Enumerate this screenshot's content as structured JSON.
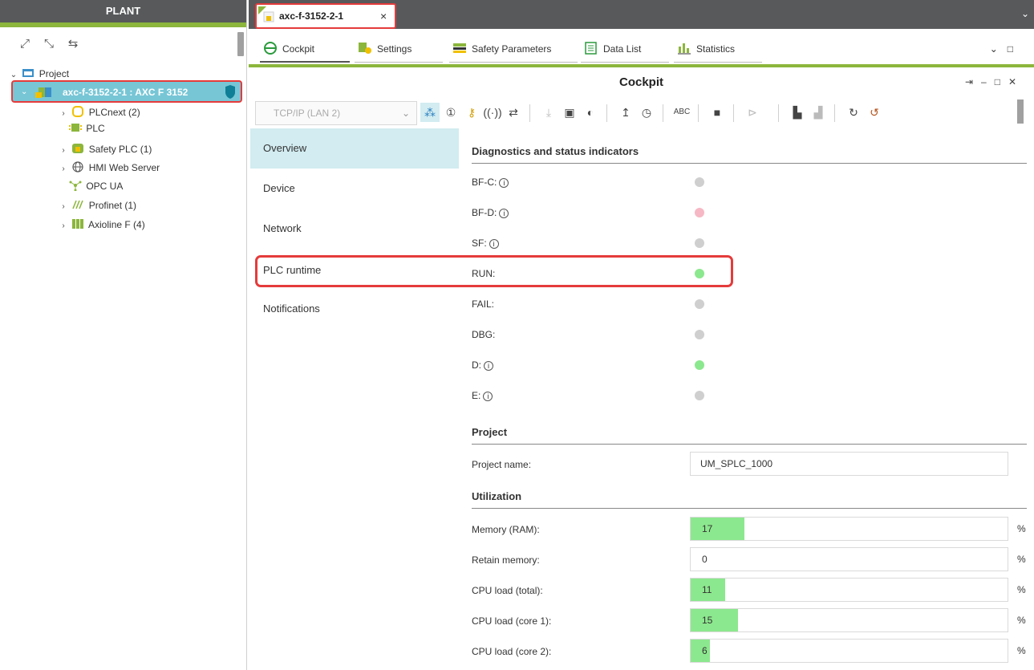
{
  "plant": {
    "title": "PLANT",
    "tree": {
      "project": "Project",
      "device": "axc-f-3152-2-1 : AXC F 3152",
      "items": [
        {
          "label": "PLCnext (2)",
          "expandable": true
        },
        {
          "label": "PLC",
          "expandable": false
        },
        {
          "label": "Safety PLC (1)",
          "expandable": true
        },
        {
          "label": "HMI Web Server",
          "expandable": true
        },
        {
          "label": "OPC UA",
          "expandable": false
        },
        {
          "label": "Profinet (1)",
          "expandable": true
        },
        {
          "label": "Axioline F (4)",
          "expandable": true
        }
      ]
    }
  },
  "doc_tab": {
    "label": "axc-f-3152-2-1",
    "close": "×"
  },
  "view_tabs": [
    "Cockpit",
    "Settings",
    "Safety Parameters",
    "Data List",
    "Statistics"
  ],
  "cockpit": {
    "title": "Cockpit",
    "connection": "TCP/IP (LAN 2)",
    "nav": [
      "Overview",
      "Device",
      "Network",
      "PLC runtime",
      "Notifications"
    ],
    "diagnostics": {
      "heading": "Diagnostics and status indicators",
      "indicators": [
        {
          "label": "BF-C:",
          "info": true,
          "color": "#cfcfcf"
        },
        {
          "label": "BF-D:",
          "info": true,
          "color": "#f6b8c4"
        },
        {
          "label": "SF:",
          "info": true,
          "color": "#cfcfcf"
        },
        {
          "label": "RUN:",
          "info": false,
          "color": "#8ce88e"
        },
        {
          "label": "FAIL:",
          "info": false,
          "color": "#cfcfcf"
        },
        {
          "label": "DBG:",
          "info": false,
          "color": "#cfcfcf"
        },
        {
          "label": "D:",
          "info": true,
          "color": "#8ce88e"
        },
        {
          "label": "E:",
          "info": true,
          "color": "#cfcfcf"
        }
      ]
    },
    "project": {
      "heading": "Project",
      "name_label": "Project name:",
      "name_value": "UM_SPLC_1000"
    },
    "utilization": {
      "heading": "Utilization",
      "unit": "%",
      "rows": [
        {
          "label": "Memory (RAM):",
          "value": "17",
          "percent": 17
        },
        {
          "label": "Retain memory:",
          "value": "0",
          "percent": 0
        },
        {
          "label": "CPU load (total):",
          "value": "11",
          "percent": 11
        },
        {
          "label": "CPU load (core 1):",
          "value": "15",
          "percent": 15
        },
        {
          "label": "CPU load (core 2):",
          "value": "6",
          "percent": 6
        }
      ]
    }
  },
  "colors": {
    "accent_green": "#8cb63c",
    "header_gray": "#57595b",
    "selection_blue": "#77c6d6",
    "highlight_red": "#e53b3b",
    "led_green": "#8ce88e"
  }
}
